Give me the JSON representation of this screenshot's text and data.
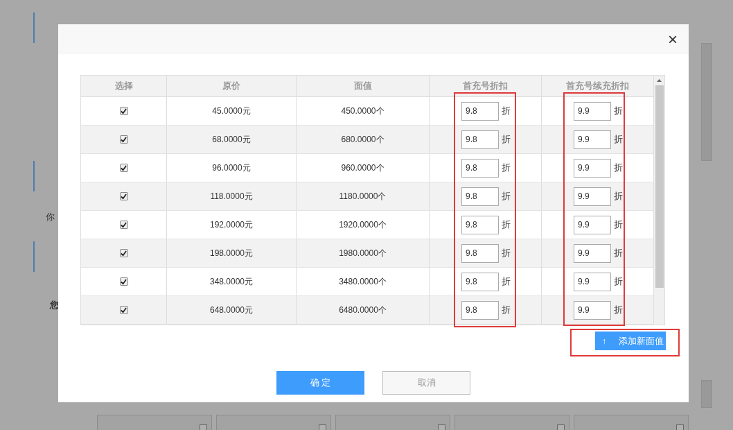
{
  "background": {
    "side_labels": [
      "你",
      "您"
    ],
    "tiles": [
      {
        "checked": false
      },
      {
        "checked": false
      },
      {
        "checked": false
      },
      {
        "checked": false
      },
      {
        "checked": false
      }
    ]
  },
  "dialog": {
    "close": "×",
    "table": {
      "columns": [
        {
          "label": "选择",
          "highlighted": false
        },
        {
          "label": "原价",
          "highlighted": false
        },
        {
          "label": "面值",
          "highlighted": false
        },
        {
          "label": "首充号折扣",
          "highlighted": true
        },
        {
          "label": "首充号续充折扣",
          "highlighted": true
        }
      ],
      "rows": [
        {
          "checked": true,
          "price": "45.0000元",
          "face_value": "450.0000个",
          "first_discount": "9.8",
          "first_unit": "折",
          "renew_discount": "9.9",
          "renew_unit": "折"
        },
        {
          "checked": true,
          "price": "68.0000元",
          "face_value": "680.0000个",
          "first_discount": "9.8",
          "first_unit": "折",
          "renew_discount": "9.9",
          "renew_unit": "折"
        },
        {
          "checked": true,
          "price": "96.0000元",
          "face_value": "960.0000个",
          "first_discount": "9.8",
          "first_unit": "折",
          "renew_discount": "9.9",
          "renew_unit": "折"
        },
        {
          "checked": true,
          "price": "118.0000元",
          "face_value": "1180.0000个",
          "first_discount": "9.8",
          "first_unit": "折",
          "renew_discount": "9.9",
          "renew_unit": "折"
        },
        {
          "checked": true,
          "price": "192.0000元",
          "face_value": "1920.0000个",
          "first_discount": "9.8",
          "first_unit": "折",
          "renew_discount": "9.9",
          "renew_unit": "折"
        },
        {
          "checked": true,
          "price": "198.0000元",
          "face_value": "1980.0000个",
          "first_discount": "9.8",
          "first_unit": "折",
          "renew_discount": "9.9",
          "renew_unit": "折"
        },
        {
          "checked": true,
          "price": "348.0000元",
          "face_value": "3480.0000个",
          "first_discount": "9.8",
          "first_unit": "折",
          "renew_discount": "9.9",
          "renew_unit": "折"
        },
        {
          "checked": true,
          "price": "648.0000元",
          "face_value": "6480.0000个",
          "first_discount": "9.8",
          "first_unit": "折",
          "renew_discount": "9.9",
          "renew_unit": "折"
        }
      ]
    },
    "add_button": {
      "icon": "↑",
      "label": "添加新面值",
      "highlighted": true
    },
    "buttons": [
      {
        "label": "确 定",
        "kind": "primary"
      },
      {
        "label": "取消",
        "kind": "secondary"
      }
    ]
  }
}
